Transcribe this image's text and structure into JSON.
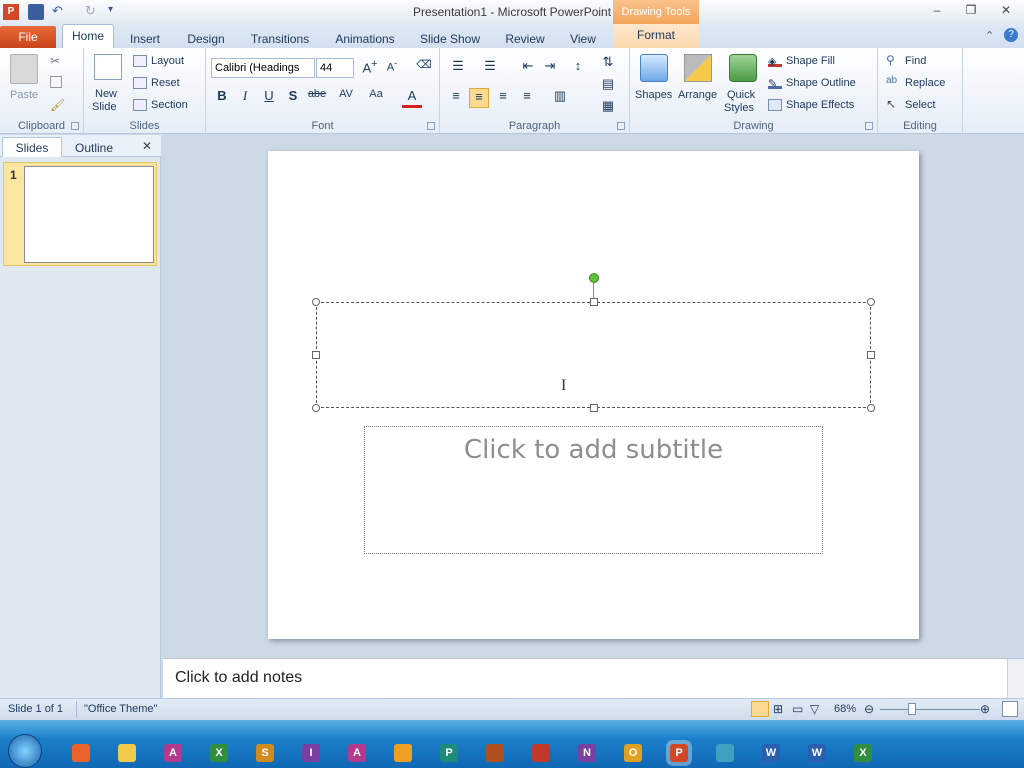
{
  "window": {
    "title": "Presentation1  -  Microsoft PowerPoint",
    "contextual_tab_group": "Drawing Tools",
    "controls": {
      "minimize": "–",
      "restore": "❐",
      "close": "✕"
    }
  },
  "tabs": [
    "File",
    "Home",
    "Insert",
    "Design",
    "Transitions",
    "Animations",
    "Slide Show",
    "Review",
    "View",
    "Format"
  ],
  "ribbon": {
    "clipboard": {
      "label": "Clipboard",
      "paste": "Paste"
    },
    "slides": {
      "label": "Slides",
      "new_slide": "New",
      "new_slide2": "Slide",
      "layout": "Layout",
      "reset": "Reset",
      "section": "Section"
    },
    "font": {
      "label": "Font",
      "font_name": "Calibri (Headings",
      "font_size": "44",
      "bold": "B",
      "italic": "I",
      "underline": "U",
      "shadow": "S",
      "strike": "abe",
      "spacing": "AV",
      "case": "Aa",
      "color": "A"
    },
    "paragraph": {
      "label": "Paragraph"
    },
    "drawing": {
      "label": "Drawing",
      "shapes": "Shapes",
      "arrange": "Arrange",
      "quick": "Quick",
      "styles": "Styles",
      "shape_fill": "Shape Fill",
      "shape_outline": "Shape Outline",
      "shape_effects": "Shape Effects"
    },
    "editing": {
      "label": "Editing",
      "find": "Find",
      "replace": "Replace",
      "select": "Select"
    }
  },
  "left_pane": {
    "tab_slides": "Slides",
    "tab_outline": "Outline",
    "close": "✕",
    "slide_number": "1"
  },
  "slide": {
    "subtitle_placeholder": "Click to add subtitle"
  },
  "notes": {
    "placeholder": "Click to add notes"
  },
  "status": {
    "slide_info": "Slide 1 of 1",
    "theme": "\"Office Theme\"",
    "zoom": "68%"
  },
  "colors": {
    "file_tab": "#c9441a",
    "drawing_tools": "#f4a45c",
    "selection_bg": "#fbe6a0",
    "taskbar": "#1a7fc9"
  },
  "taskbar": {
    "icons": [
      "firefox-icon",
      "explorer-icon",
      "access-icon",
      "excel-icon",
      "sway-icon",
      "infopath-icon",
      "access2-icon",
      "media-icon",
      "publisher-icon",
      "skype-icon",
      "project-icon",
      "onenote-icon",
      "outlook-icon",
      "powerpoint-icon",
      "paint-icon",
      "word-icon",
      "word2-icon",
      "excel2-icon"
    ],
    "letters": [
      "",
      "",
      "A",
      "X",
      "S",
      "I",
      "A",
      "",
      "P",
      "",
      "",
      "N",
      "O",
      "P",
      "",
      "W",
      "W",
      "X"
    ]
  }
}
